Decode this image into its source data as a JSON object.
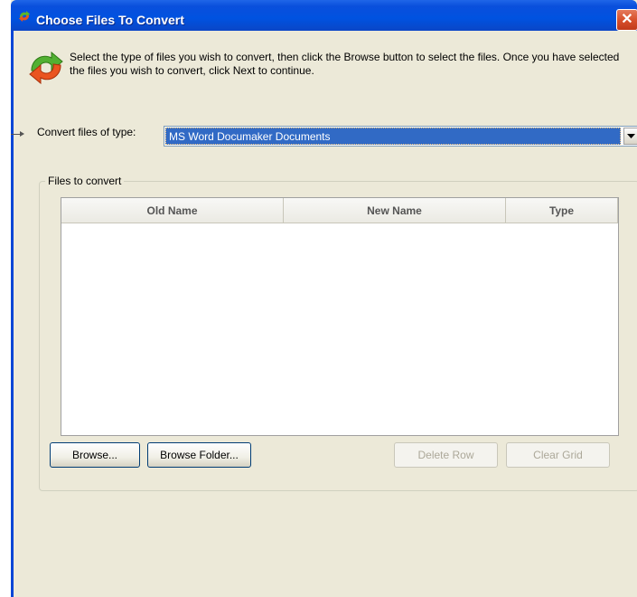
{
  "window": {
    "title": "Choose Files To Convert",
    "close_symbol": "✕",
    "title_icon": "convert-arrows-icon"
  },
  "intro": {
    "icon": "convert-arrows-icon",
    "text": "Select the type of files you wish to convert, then click the Browse button to select the files.  Once you have selected the files you wish to convert, click Next to continue."
  },
  "file_type": {
    "label": "Convert files of type:",
    "selected": "MS Word Documaker Documents"
  },
  "files_group": {
    "legend": "Files to convert",
    "columns": [
      "Old Name",
      "New Name",
      "Type"
    ],
    "rows": []
  },
  "buttons": {
    "browse": "Browse...",
    "browse_folder": "Browse Folder...",
    "delete_row": "Delete Row",
    "clear_grid": "Clear Grid"
  },
  "colors": {
    "titlebar": "#0052e0",
    "dialog_bg": "#ece9d8",
    "selection": "#316ac5",
    "close": "#d8502c"
  }
}
